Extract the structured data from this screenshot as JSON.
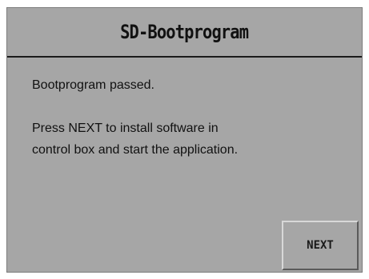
{
  "window": {
    "title": "SD-Bootprogram"
  },
  "message": {
    "line1": "Bootprogram passed.",
    "line2": "Press NEXT to install software in",
    "line3": "control box and start the application."
  },
  "actions": {
    "next_label": "NEXT"
  },
  "colors": {
    "panel_background": "#a6a6a6",
    "divider": "#1a1a1a",
    "text": "#111111"
  }
}
